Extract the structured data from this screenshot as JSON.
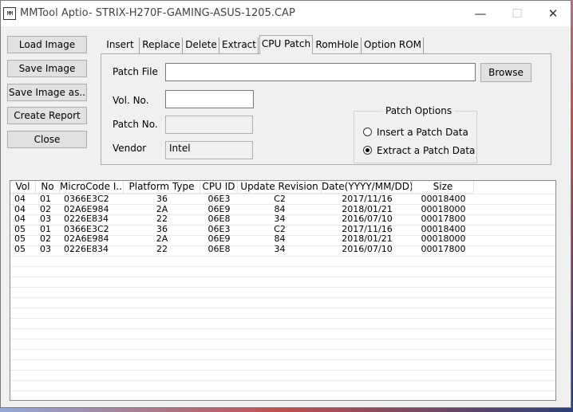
{
  "window": {
    "title": "MMTool Aptio- STRIX-H270F-GAMING-ASUS-1205.CAP",
    "app_icon_text": "MM",
    "minimize_glyph": "—",
    "maximize_glyph": "☐",
    "close_glyph": "✕"
  },
  "left_buttons": [
    "Load Image",
    "Save Image",
    "Save Image as..",
    "Create Report",
    "Close"
  ],
  "tabs": [
    "Insert",
    "Replace",
    "Delete",
    "Extract",
    "CPU Patch",
    "RomHole",
    "Option ROM"
  ],
  "active_tab": "CPU Patch",
  "cpu_patch": {
    "patch_file_label": "Patch File",
    "patch_file_value": "",
    "browse_label": "Browse",
    "vol_no_label": "Vol. No.",
    "vol_no_value": "",
    "patch_no_label": "Patch No.",
    "patch_no_value": "",
    "vendor_label": "Vendor",
    "vendor_value": "Intel",
    "options_title": "Patch Options",
    "option_insert": "Insert a Patch Data",
    "option_extract": "Extract a Patch Data",
    "selected_option": "extract"
  },
  "table": {
    "columns": [
      "Vol",
      "No",
      "MicroCode I...",
      "Platform Type",
      "CPU ID",
      "Update Revision",
      "Date(YYYY/MM/DD)",
      "Size"
    ],
    "rows": [
      [
        "04",
        "01",
        "0366E3C2",
        "36",
        "06E3",
        "C2",
        "2017/11/16",
        "00018400"
      ],
      [
        "04",
        "02",
        "02A6E984",
        "2A",
        "06E9",
        "84",
        "2018/01/21",
        "00018000"
      ],
      [
        "04",
        "03",
        "0226E834",
        "22",
        "06E8",
        "34",
        "2016/07/10",
        "00017800"
      ],
      [
        "05",
        "01",
        "0366E3C2",
        "36",
        "06E3",
        "C2",
        "2017/11/16",
        "00018400"
      ],
      [
        "05",
        "02",
        "02A6E984",
        "2A",
        "06E9",
        "84",
        "2018/01/21",
        "00018000"
      ],
      [
        "05",
        "03",
        "0226E834",
        "22",
        "06E8",
        "34",
        "2016/07/10",
        "00017800"
      ]
    ]
  }
}
